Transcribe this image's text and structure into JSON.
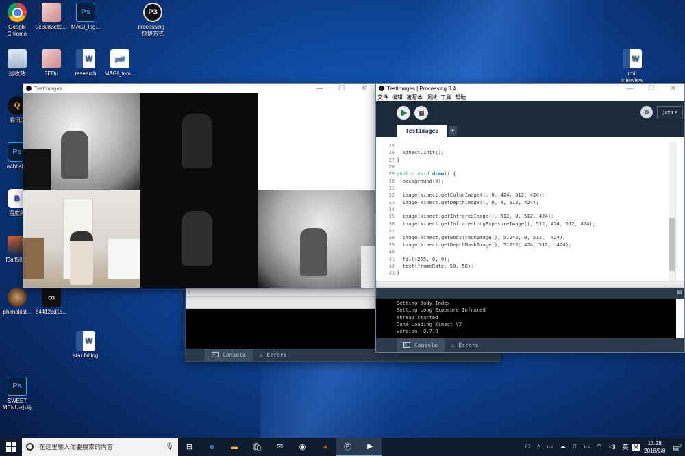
{
  "desktop": {
    "icons": [
      {
        "label": "Google\nChrome",
        "type": "chrome",
        "glyph": ""
      },
      {
        "label": "9e3083c99...",
        "type": "img",
        "glyph": ""
      },
      {
        "label": "MAGI_log...",
        "type": "ps",
        "glyph": "Ps"
      },
      {
        "label": "processing -\n快捷方式",
        "type": "proc",
        "glyph": "P3"
      },
      {
        "label": "回收站",
        "type": "recycle",
        "glyph": ""
      },
      {
        "label": "5EDu",
        "type": "img",
        "glyph": ""
      },
      {
        "label": "research",
        "type": "word",
        "glyph": "W"
      },
      {
        "label": "MAGI_tem...",
        "type": "pdf",
        "glyph": "pdf"
      },
      {
        "label": "rmit\ninterview",
        "type": "word",
        "glyph": "W"
      },
      {
        "label": "腾讯Q",
        "type": "qq",
        "glyph": "Q"
      },
      {
        "label": "e4hbsbv",
        "type": "ps",
        "glyph": "Ps"
      },
      {
        "label": "百度网",
        "type": "baidu",
        "glyph": "B"
      },
      {
        "label": "f3aff5861",
        "type": "photo",
        "glyph": ""
      },
      {
        "label": "phenakist...",
        "type": "mandala",
        "glyph": ""
      },
      {
        "label": "84412cd1a...",
        "type": "inf",
        "glyph": "∞"
      },
      {
        "label": "star falling",
        "type": "word",
        "glyph": "W"
      },
      {
        "label": "SWEET\nMENU-小马",
        "type": "ps",
        "glyph": "Ps"
      }
    ]
  },
  "sketch_window": {
    "title": "TestImages",
    "controls": [
      "—",
      "☐",
      "✕"
    ]
  },
  "ide": {
    "title": "TestImages | Processing 3.4",
    "controls": [
      "—",
      "☐",
      "✕"
    ],
    "menu": [
      "文件",
      "编辑",
      "速写本",
      "调试",
      "工具",
      "帮助"
    ],
    "mode": "Java ▾",
    "tab": "TestImages",
    "tab_arrow": "▾",
    "code_lines": [
      {
        "n": "25",
        "text": ""
      },
      {
        "n": "26",
        "text": "  kinect.init();"
      },
      {
        "n": "27",
        "text": "}"
      },
      {
        "n": "28",
        "text": ""
      },
      {
        "n": "29",
        "text": "public void draw() {"
      },
      {
        "n": "30",
        "text": "  background(0);"
      },
      {
        "n": "31",
        "text": ""
      },
      {
        "n": "32",
        "text": "  image(kinect.getColorImage(), 0, 424, 512, 424);"
      },
      {
        "n": "33",
        "text": "  image(kinect.getDepthImage(), 0, 0, 512, 424);"
      },
      {
        "n": "34",
        "text": ""
      },
      {
        "n": "35",
        "text": "  image(kinect.getInfraredImage(), 512, 0, 512, 424);"
      },
      {
        "n": "36",
        "text": "  image(kinect.getInfraredLongExposureImage(), 512, 424, 512, 424);"
      },
      {
        "n": "37",
        "text": ""
      },
      {
        "n": "38",
        "text": "  image(kinect.getBodyTrackImage(), 512*2, 0, 512,  424);"
      },
      {
        "n": "39",
        "text": "  image(kinect.getDepthMaskImage(), 512*2, 424, 512,  424);"
      },
      {
        "n": "40",
        "text": ""
      },
      {
        "n": "41",
        "text": "  fill(255, 0, 0);"
      },
      {
        "n": "42",
        "text": "  text(frameRate, 50, 50);"
      },
      {
        "n": "43",
        "text": "}"
      }
    ],
    "console_lines": [
      "Setting Body Index",
      "Setting Long Exposure Infrared",
      "thread started",
      "Done Loading Kinect V2",
      "Version: 0.7.8"
    ],
    "console_tab": "Console",
    "errors_tab": "Errors"
  },
  "back_console": {
    "console_tab": "Console",
    "errors_tab": "Errors"
  },
  "taskbar": {
    "search_placeholder": "在这里输入你要搜索的内容",
    "time": "13:28",
    "date": "2018/9/8",
    "ime": "英",
    "ime2": "M",
    "notif": "2"
  }
}
